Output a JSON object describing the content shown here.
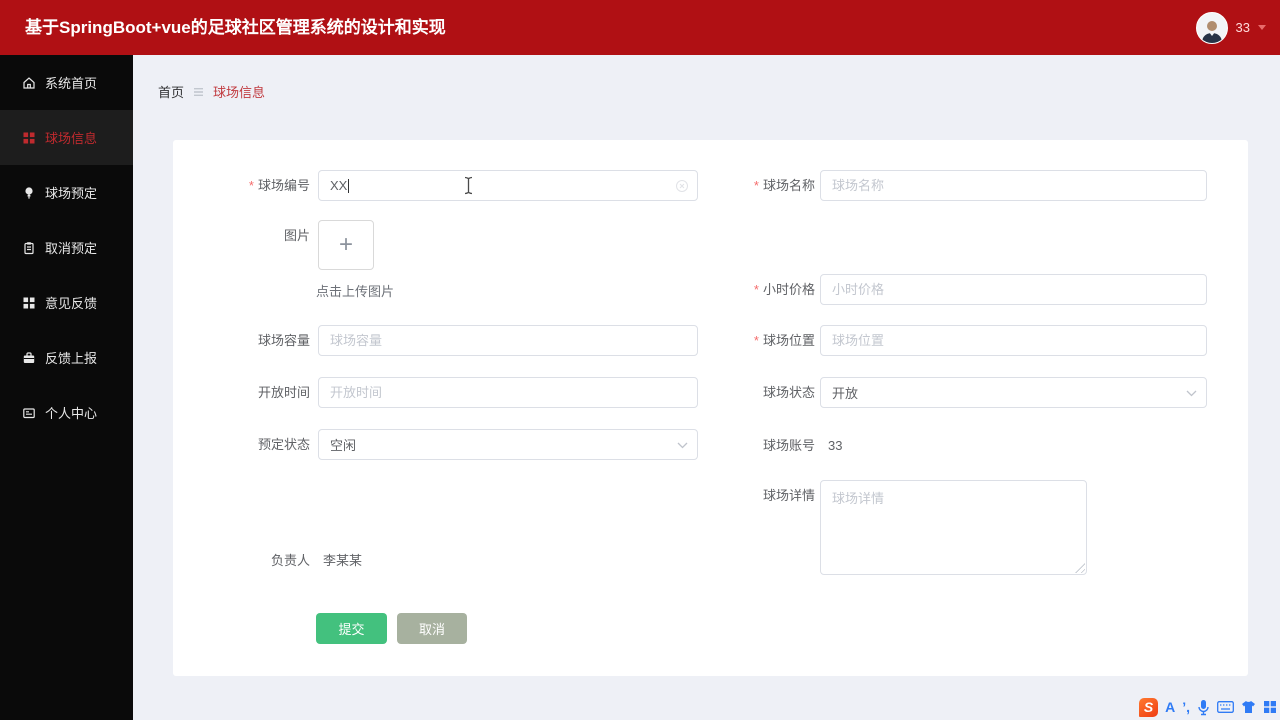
{
  "header": {
    "title": "基于SpringBoot+vue的足球社区管理系统的设计和实现",
    "user": {
      "name": "33"
    }
  },
  "sidebar": {
    "items": [
      {
        "label": "系统首页",
        "icon": "home-icon"
      },
      {
        "label": "球场信息",
        "icon": "grid-icon",
        "active": true
      },
      {
        "label": "球场预定",
        "icon": "pin-icon"
      },
      {
        "label": "取消预定",
        "icon": "clipboard-icon"
      },
      {
        "label": "意见反馈",
        "icon": "grid-icon"
      },
      {
        "label": "反馈上报",
        "icon": "briefcase-icon"
      },
      {
        "label": "个人中心",
        "icon": "card-icon"
      }
    ]
  },
  "breadcrumb": {
    "home": "首页",
    "current": "球场信息"
  },
  "form": {
    "required_mark": "*",
    "field_no": {
      "label": "球场编号",
      "value": "XX"
    },
    "image": {
      "label": "图片",
      "plus": "+",
      "hint": "点击上传图片"
    },
    "capacity": {
      "label": "球场容量",
      "placeholder": "球场容量"
    },
    "open_time": {
      "label": "开放时间",
      "placeholder": "开放时间"
    },
    "booking_status": {
      "label": "预定状态",
      "value": "空闲"
    },
    "manager": {
      "label": "负责人",
      "value": "李某某"
    },
    "name": {
      "label": "球场名称",
      "placeholder": "球场名称"
    },
    "hour_price": {
      "label": "小时价格",
      "placeholder": "小时价格"
    },
    "location": {
      "label": "球场位置",
      "placeholder": "球场位置"
    },
    "field_status": {
      "label": "球场状态",
      "value": "开放"
    },
    "account": {
      "label": "球场账号",
      "value": "33"
    },
    "details": {
      "label": "球场详情",
      "placeholder": "球场详情"
    }
  },
  "actions": {
    "submit": "提交",
    "cancel": "取消"
  },
  "ime": {
    "logo": "S",
    "letter": "A",
    "punct": "’,"
  },
  "colors": {
    "header_red": "#b01014",
    "accent_red": "#bf2a2e",
    "submit_green": "#43c17e",
    "cancel_gray": "#a7b19f",
    "ime_blue": "#2f7bf5"
  }
}
